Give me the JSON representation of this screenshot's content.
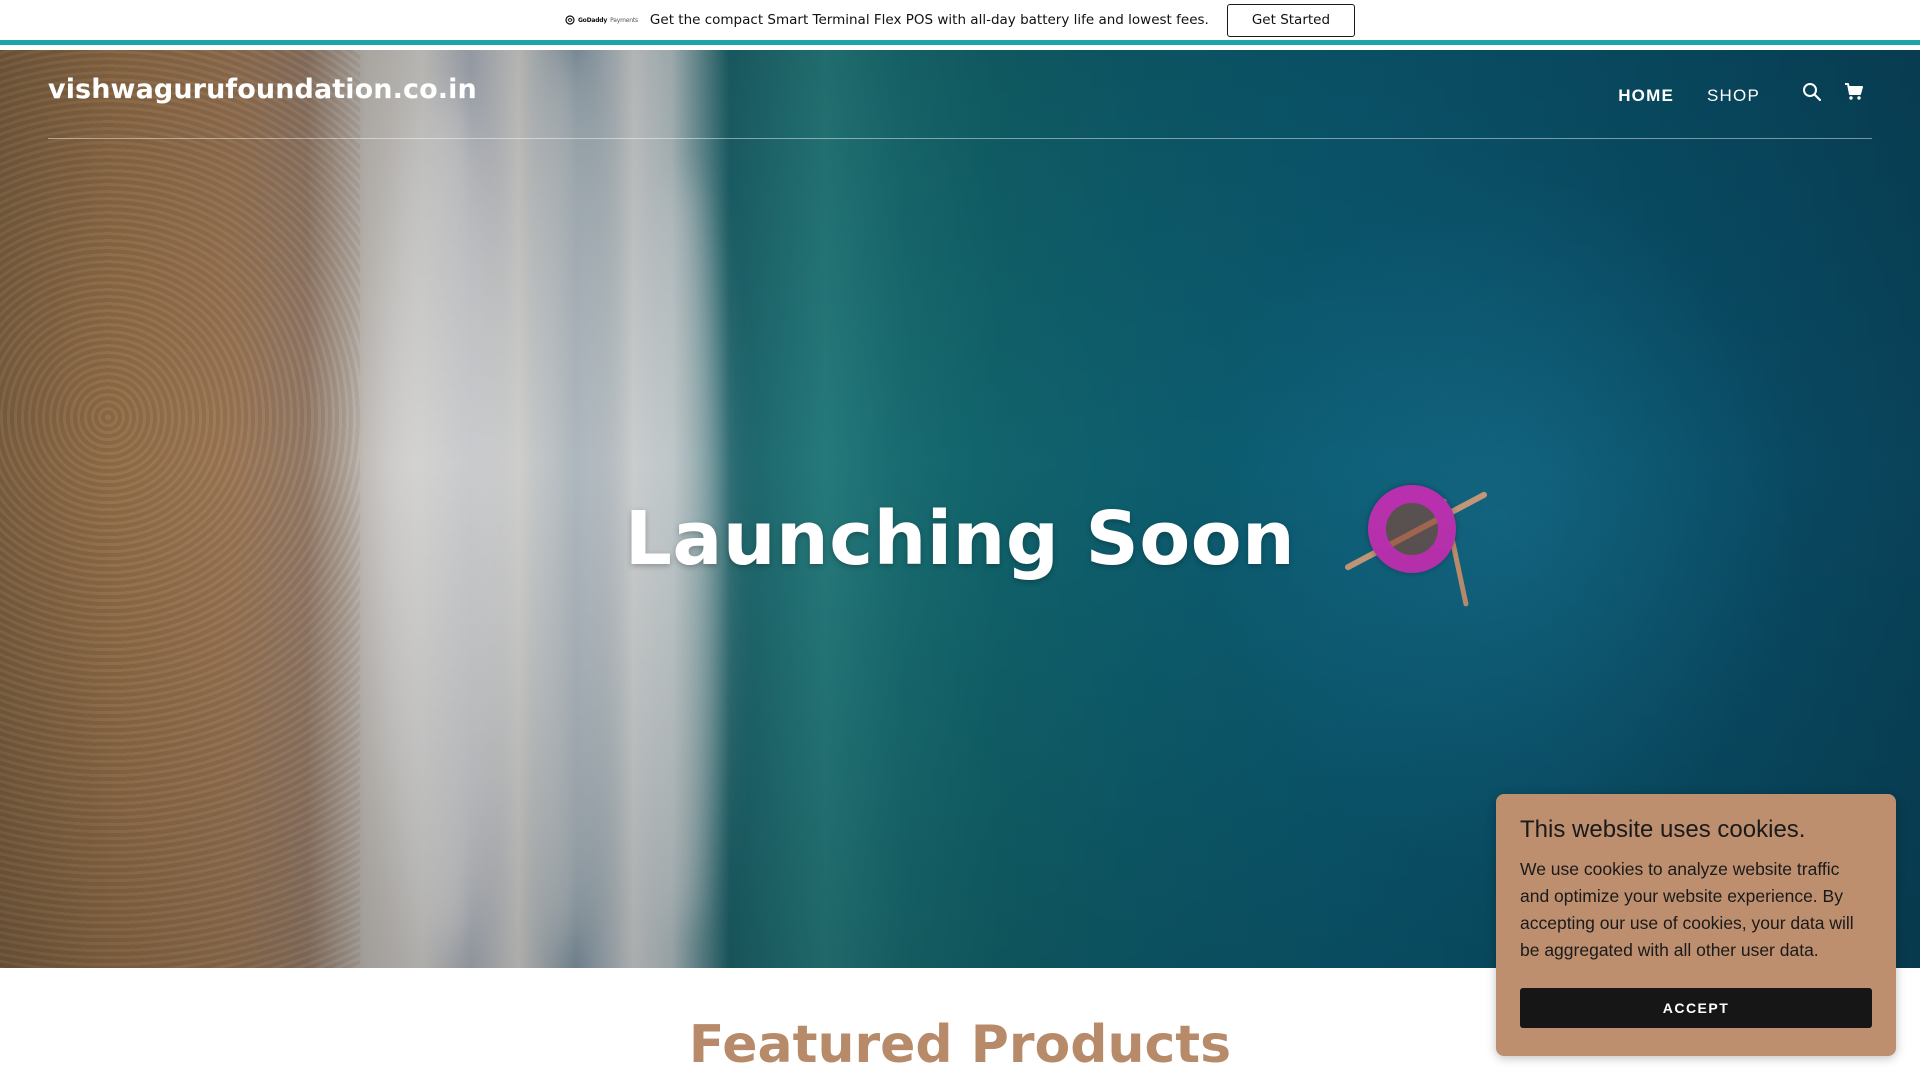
{
  "promo": {
    "logo_brand": "GoDaddy",
    "logo_product": "Payments",
    "message": "Get the compact Smart Terminal Flex POS with all-day battery life and lowest fees.",
    "cta_label": "Get Started",
    "accent_color": "#1fa3ab"
  },
  "header": {
    "site_name": "vishwagurufoundation.co.in",
    "nav": [
      {
        "label": "HOME",
        "active": true
      },
      {
        "label": "SHOP",
        "active": false
      }
    ],
    "icons": [
      "search-icon",
      "cart-icon"
    ]
  },
  "hero": {
    "title": "Launching Soon"
  },
  "featured": {
    "heading": "Featured Products",
    "heading_color": "#b78b6a"
  },
  "cookie_banner": {
    "title": "This website uses cookies.",
    "text": "We use cookies to analyze website traffic and optimize your website experience. By accepting our use of cookies, your data will be aggregated with all other user data.",
    "accept_label": "ACCEPT",
    "background_color": "#bd8f6f"
  }
}
